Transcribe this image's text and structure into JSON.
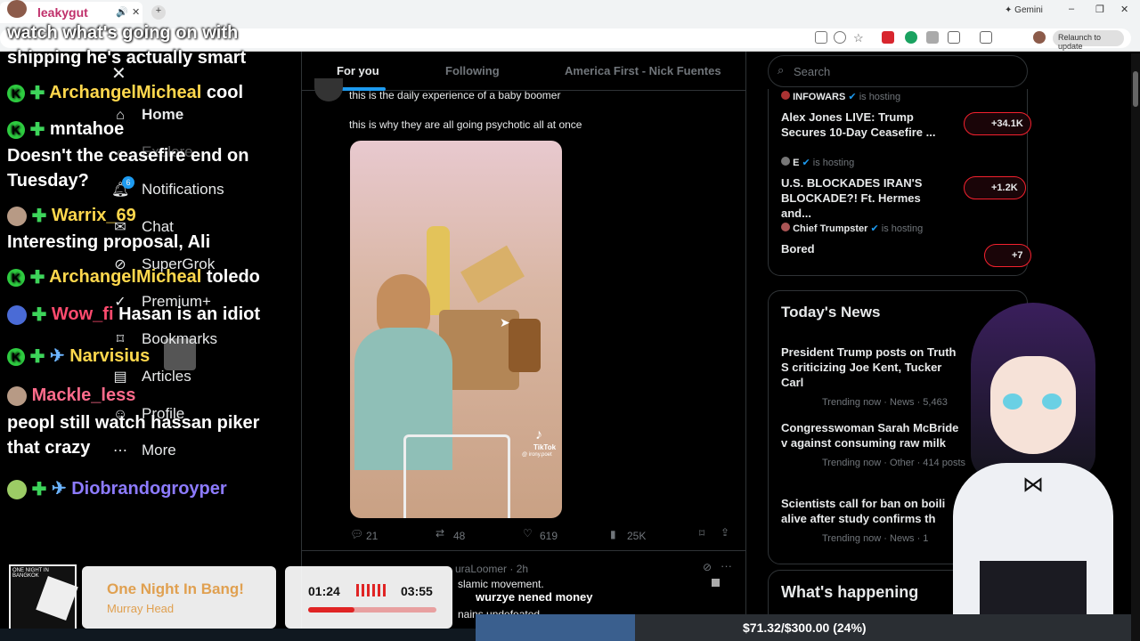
{
  "browser": {
    "tab_title": "leakygut",
    "gemini_label": "Gemini",
    "relaunch_label": "Relaunch to update",
    "window_controls": [
      "–",
      "❐",
      "✕"
    ]
  },
  "chat": [
    {
      "text": "watch what's going on with"
    },
    {
      "text": "shipping he's actually smart"
    },
    {
      "user": "ArchangelMicheal",
      "msg": "cool"
    },
    {
      "user": "mntahoe"
    },
    {
      "text": "Doesn't the ceasefire end on"
    },
    {
      "text": "Tuesday?"
    },
    {
      "user": "Warrix_69"
    },
    {
      "text": "Interesting proposal, Ali"
    },
    {
      "user": "ArchangelMicheal",
      "msg": "toledo"
    },
    {
      "user": "Wow_fi",
      "msg": "Hasan is an idiot"
    },
    {
      "user": "Narvisius"
    },
    {
      "user": "Mackle_less"
    },
    {
      "text": "peopl still watch hassan piker"
    },
    {
      "text": "that crazy"
    },
    {
      "user": "Diobrandogroyper"
    }
  ],
  "nav": {
    "home": "Home",
    "explore": "Explore",
    "notifications": "Notifications",
    "notifications_badge": "6",
    "chat": "Chat",
    "supergrok": "SuperGrok",
    "premium": "Premium+",
    "bookmarks": "Bookmarks",
    "articles": "Articles",
    "profile": "Profile",
    "more": "More"
  },
  "feed": {
    "tabs": [
      "For you",
      "Following",
      "America First - Nick Fuentes"
    ],
    "post": {
      "line1": "this is the daily experience of a baby boomer",
      "line2": "this is why they are all going psychotic all at once",
      "media_watermark": "TikTok",
      "media_handle": "@ irony.poet",
      "replies": "21",
      "reposts": "48",
      "likes": "619",
      "views": "25K"
    },
    "next_post": {
      "author": "uraLoomer",
      "time": "· 2h",
      "text": "slamic movement.",
      "text2": "nains undefeated"
    }
  },
  "caption": "wurzye nened money",
  "right": {
    "search_placeholder": "Search",
    "spaces": [
      {
        "host": "INFOWARS",
        "host_suffix": "is hosting",
        "title": "Alex Jones LIVE: Trump Secures 10-Day Ceasefire ...",
        "count": "+34.1K"
      },
      {
        "host": "E",
        "host_suffix": "is hosting",
        "title": "U.S. BLOCKADES IRAN'S BLOCKADE?! Ft. Hermes and...",
        "count": "+1.2K"
      },
      {
        "host": "Chief Trumpster",
        "host_suffix": "is hosting",
        "title": "Bored",
        "count": "+7"
      }
    ],
    "news_title": "Today's News",
    "news": [
      {
        "headline": "President Trump posts on Truth S criticizing Joe Kent, Tucker Carl",
        "meta": "Trending now · News · 5,463"
      },
      {
        "headline": "Congresswoman Sarah McBride v against consuming raw milk",
        "meta": "Trending now · Other · 414 posts"
      },
      {
        "headline": "Scientists call for ban on boili alive after study confirms th",
        "meta": "Trending now · News · 1"
      }
    ],
    "whats_happening": "What's happening"
  },
  "music": {
    "title": "One Night In Bang!",
    "artist": "Murray Head",
    "album_art_text": "ONE NIGHT IN BANGKOK"
  },
  "timer": {
    "elapsed": "01:24",
    "total": "03:55",
    "progress": 0.36
  },
  "goal": {
    "text": "$71.32/$300.00 (24%)",
    "progress": 0.24
  },
  "colors": {
    "accent": "#1d9bf0",
    "live_red": "#f4212e",
    "chat_green": "#3dd45a"
  }
}
